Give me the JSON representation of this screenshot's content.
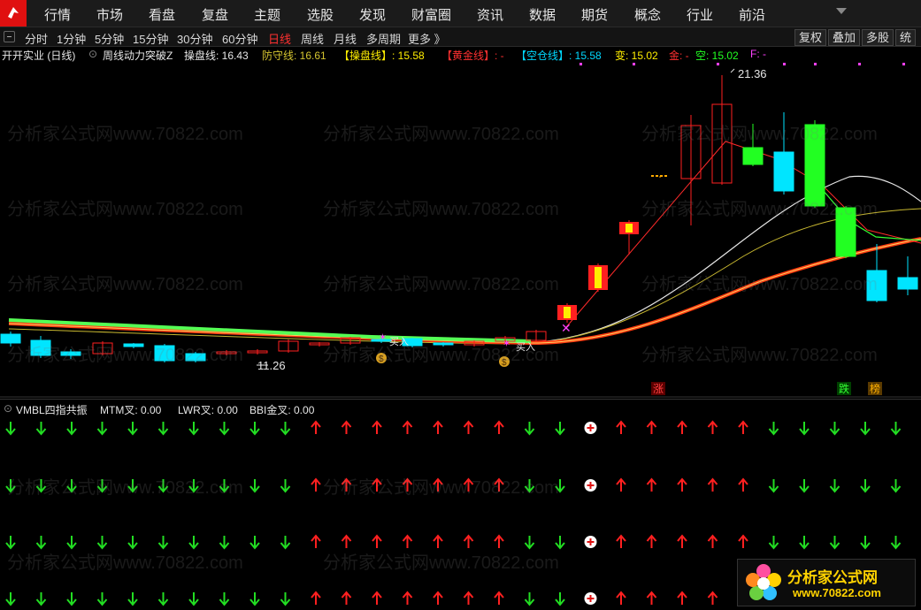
{
  "menu": [
    "行情",
    "市场",
    "看盘",
    "复盘",
    "主题",
    "选股",
    "发现",
    "财富圈",
    "资讯",
    "数据",
    "期货",
    "概念",
    "行业",
    "前沿"
  ],
  "periods": {
    "items": [
      "分时",
      "1分钟",
      "5分钟",
      "15分钟",
      "30分钟",
      "60分钟",
      "日线",
      "周线",
      "月线",
      "多周期",
      "更多 》"
    ],
    "active": "日线"
  },
  "right_buttons": [
    "复权",
    "叠加",
    "多股",
    "统"
  ],
  "info": {
    "stock": "开开实业 (日线)",
    "indicator": "周线动力突破Z",
    "cao_label": "操盘线: 16.43",
    "fang_label": "防守线: 16.61",
    "cao_bracket": "【操盘线】: 15.58",
    "gold_bracket": "【黄金线】: -",
    "short_bracket": "【空仓线】: 15.58",
    "bian": "变: 15.02",
    "jin": "金: -",
    "kong": "空: 15.02",
    "f": "F: -"
  },
  "main_chart": {
    "price_high_label": "21.36",
    "price_low_label": "11.26",
    "buy_label": "买入",
    "zhang_label": "涨",
    "die_label": "跌",
    "bang_label": "榜",
    "colors": {
      "up": "#ff2020",
      "down": "#00e5ff",
      "yellow": "#ffee00",
      "green": "#22ff22"
    }
  },
  "panel2": {
    "title": "VMBL四指共振",
    "mtm": "MTM叉: 0.00",
    "lwr": "LWR叉: 0.00",
    "bbi": "BBI金叉: 0.00",
    "arrow_dirs": [
      "d",
      "d",
      "d",
      "d",
      "d",
      "d",
      "d",
      "d",
      "d",
      "d",
      "u",
      "u",
      "u",
      "u",
      "u",
      "u",
      "u",
      "d",
      "d",
      "c",
      "u",
      "u",
      "u",
      "u",
      "u",
      "d",
      "d",
      "d",
      "d",
      "d",
      "d"
    ]
  },
  "watermark_text": "分析家公式网www.70822.com",
  "brand": {
    "title": "分析家公式网",
    "url": "www.70822.com"
  }
}
